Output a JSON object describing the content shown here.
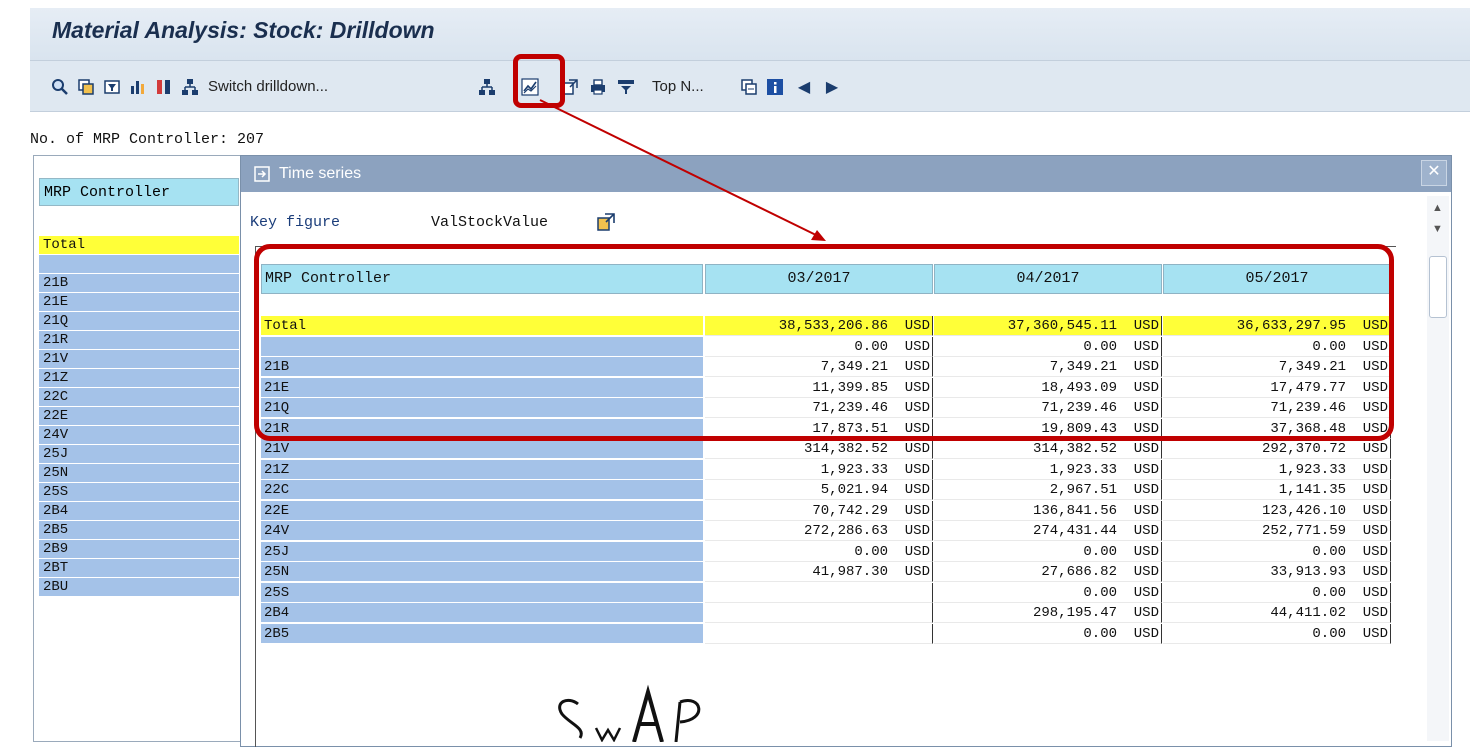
{
  "window": {
    "title": "Material Analysis: Stock: Drilldown"
  },
  "toolbar": {
    "switch_drilldown_label": "Switch drilldown...",
    "top_n_label": "Top N...",
    "prev_label": "◀",
    "next_label": "▶"
  },
  "summary": {
    "mrp_count": "No. of MRP Controller: 207"
  },
  "left_list": {
    "header": "MRP Controller",
    "items": [
      "Total",
      "",
      "21B",
      "21E",
      "21Q",
      "21R",
      "21V",
      "21Z",
      "22C",
      "22E",
      "24V",
      "25J",
      "25N",
      "25S",
      "2B4",
      "2B5",
      "2B9",
      "2BT",
      "2BU"
    ]
  },
  "dialog": {
    "title": "Time series",
    "close_label": "✕",
    "key_figure_label": "Key figure",
    "key_figure_value": "ValStockValue",
    "table": {
      "headers": [
        "MRP Controller",
        "03/2017",
        "04/2017",
        "05/2017"
      ],
      "rows": [
        {
          "name": "Total",
          "v": [
            "38,533,206.86",
            "37,360,545.11",
            "36,633,297.95"
          ],
          "cur": "USD"
        },
        {
          "name": "",
          "v": [
            "0.00",
            "0.00",
            "0.00"
          ],
          "cur": "USD"
        },
        {
          "name": "21B",
          "v": [
            "7,349.21",
            "7,349.21",
            "7,349.21"
          ],
          "cur": "USD"
        },
        {
          "name": "21E",
          "v": [
            "11,399.85",
            "18,493.09",
            "17,479.77"
          ],
          "cur": "USD"
        },
        {
          "name": "21Q",
          "v": [
            "71,239.46",
            "71,239.46",
            "71,239.46"
          ],
          "cur": "USD"
        },
        {
          "name": "21R",
          "v": [
            "17,873.51",
            "19,809.43",
            "37,368.48"
          ],
          "cur": "USD"
        },
        {
          "name": "21V",
          "v": [
            "314,382.52",
            "314,382.52",
            "292,370.72"
          ],
          "cur": "USD"
        },
        {
          "name": "21Z",
          "v": [
            "1,923.33",
            "1,923.33",
            "1,923.33"
          ],
          "cur": "USD"
        },
        {
          "name": "22C",
          "v": [
            "5,021.94",
            "2,967.51",
            "1,141.35"
          ],
          "cur": "USD"
        },
        {
          "name": "22E",
          "v": [
            "70,742.29",
            "136,841.56",
            "123,426.10"
          ],
          "cur": "USD"
        },
        {
          "name": "24V",
          "v": [
            "272,286.63",
            "274,431.44",
            "252,771.59"
          ],
          "cur": "USD"
        },
        {
          "name": "25J",
          "v": [
            "0.00",
            "0.00",
            "0.00"
          ],
          "cur": "USD"
        },
        {
          "name": "25N",
          "v": [
            "41,987.30",
            "27,686.82",
            "33,913.93"
          ],
          "cur": "USD"
        },
        {
          "name": "25S",
          "v": [
            "",
            "0.00",
            "0.00"
          ],
          "cur": "USD"
        },
        {
          "name": "2B4",
          "v": [
            "",
            "298,195.47",
            "44,411.02"
          ],
          "cur": "USD"
        },
        {
          "name": "2B5",
          "v": [
            "",
            "0.00",
            "0.00"
          ],
          "cur": "USD"
        }
      ]
    }
  },
  "signature": {
    "text": "SwAP"
  },
  "colors": {
    "highlight_red": "#c00000",
    "header_cyan": "#a6e2f2",
    "row_blue": "#a4c2e8",
    "total_yellow": "#ffff38",
    "dialog_title": "#8ca2bf"
  }
}
